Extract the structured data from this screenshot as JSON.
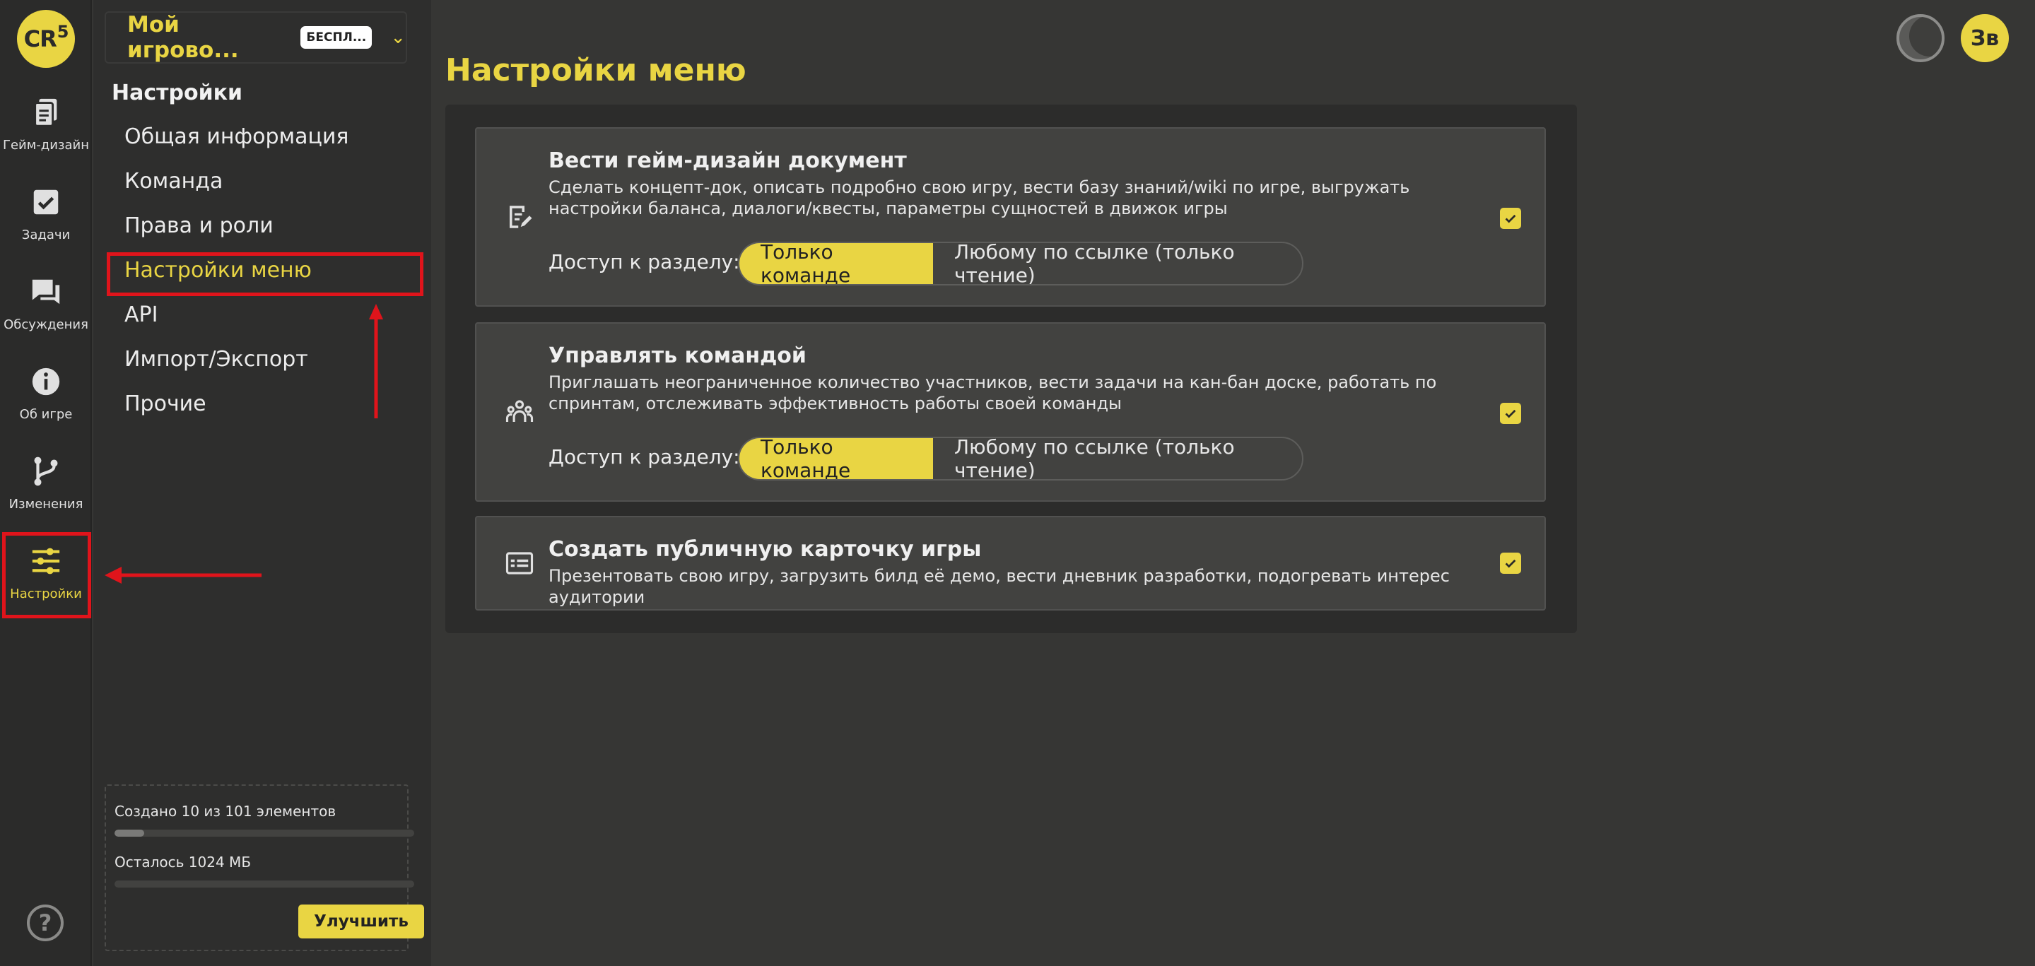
{
  "app": {
    "logo_text": "CR",
    "logo_sup": "5"
  },
  "rail": {
    "items": [
      {
        "label": "Гейм-дизайн",
        "icon": "document-icon"
      },
      {
        "label": "Задачи",
        "icon": "task-check-icon"
      },
      {
        "label": "Обсуждения",
        "icon": "chat-icon"
      },
      {
        "label": "Об игре",
        "icon": "info-icon"
      },
      {
        "label": "Изменения",
        "icon": "git-branch-icon"
      },
      {
        "label": "Настройки",
        "icon": "sliders-icon",
        "active": true
      }
    ],
    "help_glyph": "?"
  },
  "project": {
    "name": "Мой игрово...",
    "plan_badge": "БЕСПЛ...",
    "chevron": "⌄"
  },
  "settings_menu": {
    "title": "Настройки",
    "items": [
      {
        "label": "Общая информация"
      },
      {
        "label": "Команда"
      },
      {
        "label": "Права и роли"
      },
      {
        "label": "Настройки меню",
        "active": true
      },
      {
        "label": "API"
      },
      {
        "label": "Импорт/Экспорт"
      },
      {
        "label": "Прочие"
      }
    ]
  },
  "usage": {
    "elements_label": "Создано 10 из 101 элементов",
    "elements_fraction": 0.099,
    "storage_label": "Осталось 1024 МБ",
    "storage_fraction": 0.0,
    "upgrade_label": "Улучшить"
  },
  "header": {
    "user_initials": "Зв"
  },
  "page": {
    "title": "Настройки меню"
  },
  "cards": [
    {
      "title": "Вести гейм-дизайн документ",
      "description": "Сделать концепт-док, описать подробно свою игру, вести базу знаний/wiki по игре, выгружать настройки баланса, диалоги/квесты, параметры сущностей в движок игры",
      "icon": "edit-document-icon",
      "access_label": "Доступ к разделу:",
      "options": [
        "Только команде",
        "Любому по ссылке (только чтение)"
      ],
      "selected": "Только команде",
      "checked": true
    },
    {
      "title": "Управлять командой",
      "description": "Приглашать неограниченное количество участников, вести задачи на кан-бан доске, работать по спринтам, отслеживать эффективность работы своей команды",
      "icon": "team-icon",
      "access_label": "Доступ к разделу:",
      "options": [
        "Только команде",
        "Любому по ссылке (только чтение)"
      ],
      "selected": "Только команде",
      "checked": true
    },
    {
      "title": "Создать публичную карточку игры",
      "description": "Презентовать свою игру, загрузить билд её демо, вести дневник разработки, подогревать интерес аудитории",
      "icon": "id-card-icon",
      "checked": true
    }
  ],
  "colors": {
    "accent": "#e9d543",
    "background": "#363634",
    "rail": "#2b2b2a",
    "sidebar": "#2e2e2d",
    "card": "#424240",
    "annotation": "#e0141b"
  }
}
